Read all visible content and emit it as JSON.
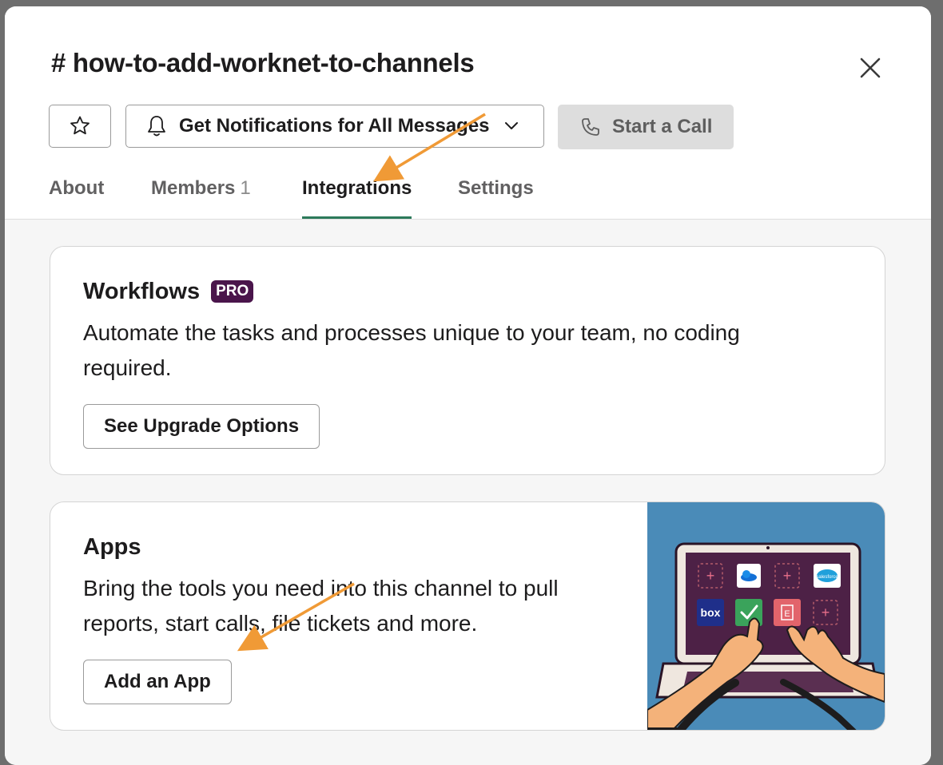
{
  "channel": {
    "title": "# how-to-add-worknet-to-channels"
  },
  "toolbar": {
    "star_icon": "star-icon",
    "notifications_label": "Get Notifications for All Messages",
    "bell_icon": "bell-icon",
    "chevron_icon": "chevron-down-icon",
    "call_label": "Start a Call",
    "phone_icon": "phone-icon"
  },
  "tabs": [
    {
      "label": "About",
      "active": false
    },
    {
      "label": "Members",
      "count": "1",
      "active": false
    },
    {
      "label": "Integrations",
      "active": true
    },
    {
      "label": "Settings",
      "active": false
    }
  ],
  "workflows": {
    "title": "Workflows",
    "badge": "PRO",
    "description": "Automate the tasks and processes unique to your team, no coding required.",
    "button_label": "See Upgrade Options"
  },
  "apps": {
    "title": "Apps",
    "description": "Bring the tools you need into this channel to pull reports, start calls, file tickets and more.",
    "button_label": "Add an App",
    "illustration": {
      "app_tiles": [
        "plus",
        "onedrive",
        "plus",
        "salesforce",
        "box",
        "check",
        "evernote",
        "plus"
      ],
      "box_label": "box",
      "salesforce_label": "salesforce"
    }
  },
  "colors": {
    "accent_tab": "#2c7a5b",
    "pro_badge": "#4a154b",
    "annotation_arrow": "#f09a36",
    "illustration_bg": "#4a8bb8"
  }
}
